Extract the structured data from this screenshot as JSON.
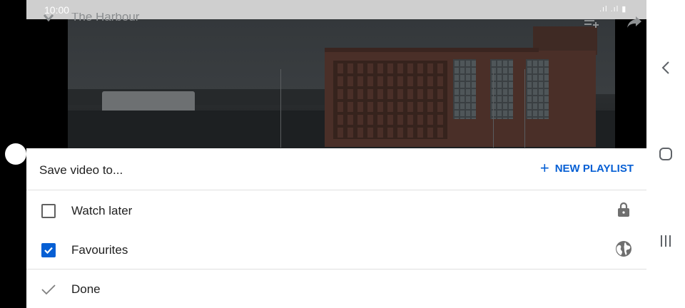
{
  "status_bar": {
    "time": "10:00",
    "icons": ".ıl .ıl ▮"
  },
  "video": {
    "title": "The Harbour"
  },
  "nav": {
    "back": "back-icon",
    "home": "home-icon",
    "recents": "recents-icon"
  },
  "sheet": {
    "title": "Save video to...",
    "new_playlist_label": "NEW PLAYLIST",
    "playlists": [
      {
        "label": "Watch later",
        "checked": false,
        "privacy": "lock-icon"
      },
      {
        "label": "Favourites",
        "checked": true,
        "privacy": "globe-icon"
      }
    ],
    "done_label": "Done"
  },
  "colors": {
    "accent": "#065fd4",
    "text": "#212121",
    "divider": "#e0e0e0"
  }
}
